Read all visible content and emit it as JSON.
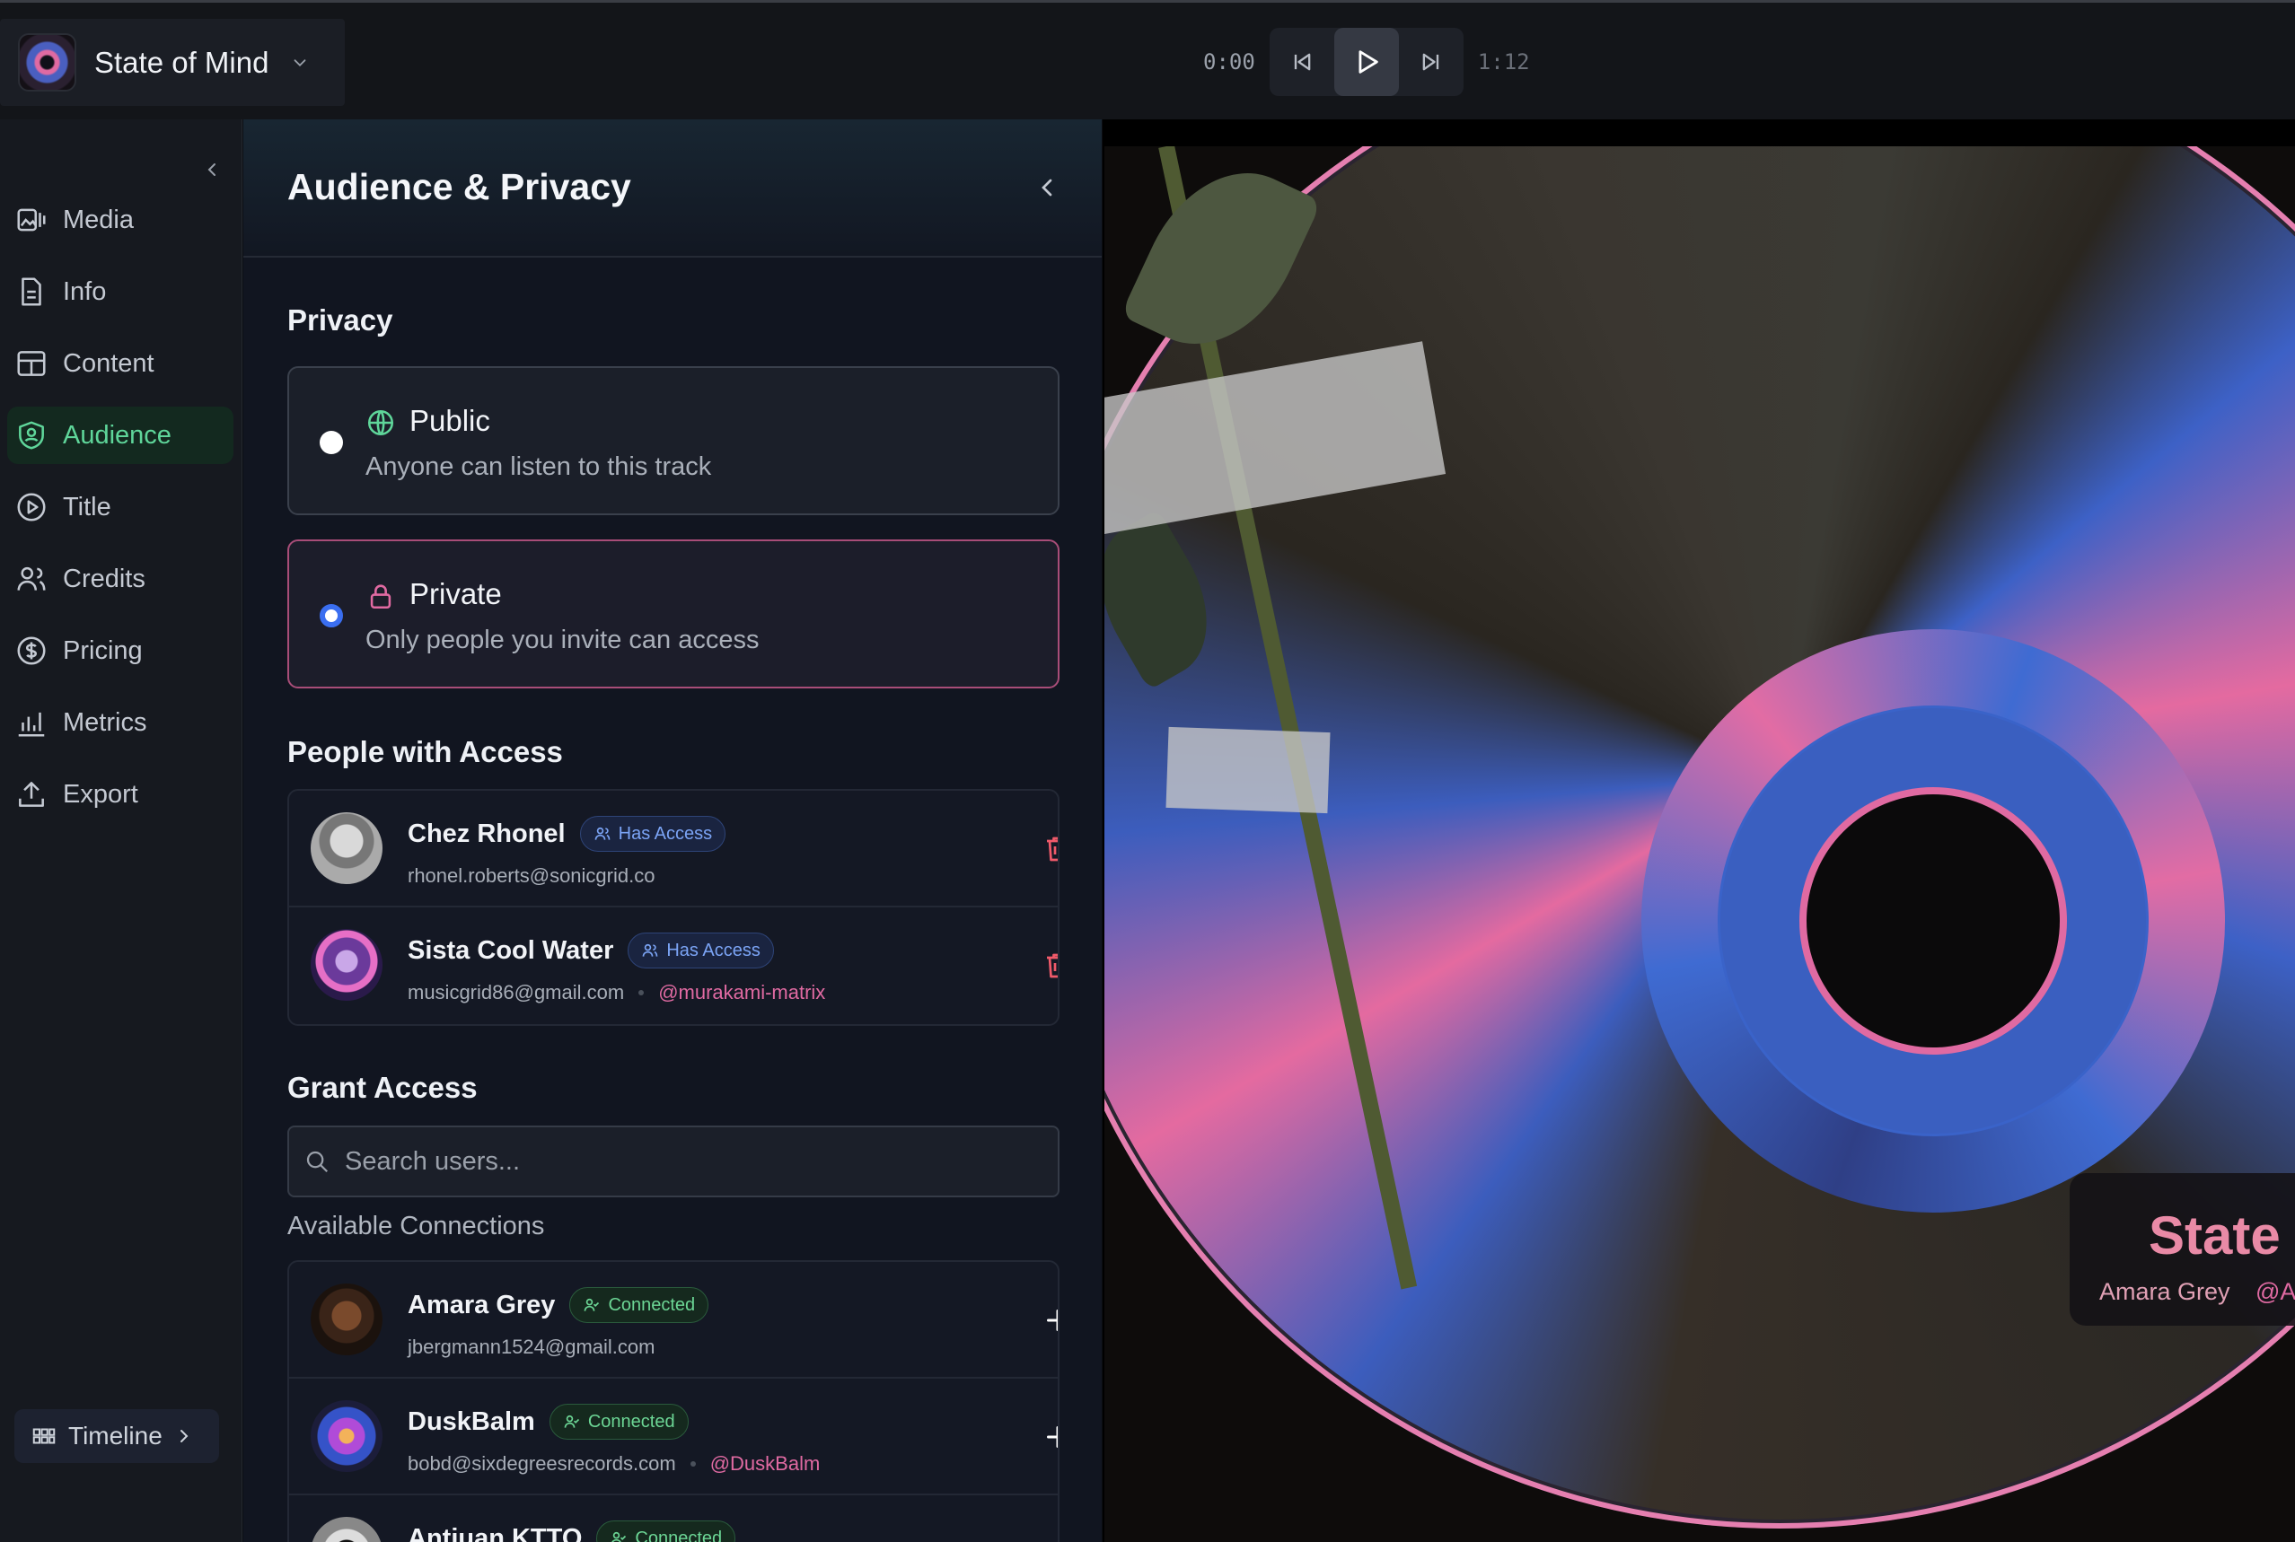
{
  "project": {
    "title": "State of Mind"
  },
  "transport": {
    "current_time": "0:00",
    "total_time": "1:12"
  },
  "nav": {
    "items": [
      {
        "label": "Media",
        "icon": "media-icon"
      },
      {
        "label": "Info",
        "icon": "document-icon"
      },
      {
        "label": "Content",
        "icon": "table-icon"
      },
      {
        "label": "Audience",
        "icon": "shield-user-icon",
        "active": true
      },
      {
        "label": "Title",
        "icon": "play-circle-icon"
      },
      {
        "label": "Credits",
        "icon": "users-icon"
      },
      {
        "label": "Pricing",
        "icon": "dollar-circle-icon"
      },
      {
        "label": "Metrics",
        "icon": "bar-chart-icon"
      },
      {
        "label": "Export",
        "icon": "upload-icon"
      }
    ],
    "timeline_label": "Timeline"
  },
  "panel": {
    "title": "Audience & Privacy",
    "privacy_heading": "Privacy",
    "public": {
      "label": "Public",
      "desc": "Anyone can listen to this track",
      "selected": false
    },
    "private": {
      "label": "Private",
      "desc": "Only people you invite can access",
      "selected": true
    },
    "people_heading": "People with Access",
    "people": [
      {
        "name": "Chez Rhonel",
        "badge": "Has Access",
        "email": "rhonel.roberts@sonicgrid.co",
        "handle": ""
      },
      {
        "name": "Sista Cool Water",
        "badge": "Has Access",
        "email": "musicgrid86@gmail.com",
        "handle": "@murakami-matrix"
      }
    ],
    "grant_heading": "Grant Access",
    "search_placeholder": "Search users...",
    "available_heading": "Available Connections",
    "connections": [
      {
        "name": "Amara Grey",
        "badge": "Connected",
        "email": "jbergmann1524@gmail.com",
        "handle": ""
      },
      {
        "name": "DuskBalm",
        "badge": "Connected",
        "email": "bobd@sixdegreesrecords.com",
        "handle": "@DuskBalm"
      },
      {
        "name": "Antiuan KTTO",
        "badge": "Connected",
        "email": "",
        "handle": ""
      }
    ]
  },
  "preview": {
    "title": "State",
    "artist": "Amara Grey",
    "handle": "@A"
  },
  "colors": {
    "accent_green": "#5fd69a",
    "accent_pink": "#e06aa2",
    "accent_blue": "#3a6ef0"
  }
}
